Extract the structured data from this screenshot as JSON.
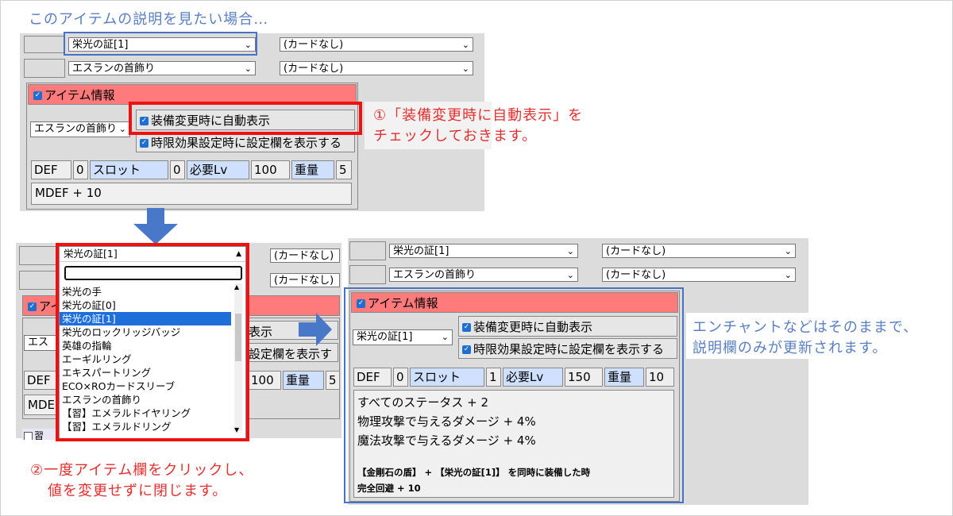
{
  "top_note": "このアイテムの説明を見たい場合…",
  "panel1": {
    "item_select_1": "栄光の証[1]",
    "card_select_1": "(カードなし)",
    "item_select_2": "エスランの首飾り",
    "card_select_2": "(カードなし)",
    "header": "アイテム情報",
    "item_dropdown": "エスランの首飾り",
    "opt_auto_display": "装備変更時に自動表示",
    "opt_timed_effect": "時限効果設定時に設定欄を表示する",
    "stats": [
      "DEF",
      "0",
      "スロット",
      "0",
      "必要Lv",
      "100",
      "重量",
      "5"
    ],
    "desc": "MDEF + 10"
  },
  "note1": [
    "①「装備変更時に自動表示」を",
    "チェックしておきます。"
  ],
  "panel2": {
    "dropdown_selected": "栄光の証[1]",
    "card_select_1": "(カードなし)",
    "card_select_2": "(カードなし)",
    "header_partial": "アイ",
    "item_partial": "エス",
    "opt_partial": "表示",
    "opt2_partial": "設定欄を表示す",
    "stats_partial": [
      "DEF",
      "100",
      "重量",
      "5"
    ],
    "desc_partial": "MDEF",
    "bottom_partial": "習",
    "list": [
      "栄光の手",
      "栄光の証[0]",
      "栄光の証[1]",
      "栄光のロックリッジバッジ",
      "英雄の指輪",
      "エーギルリング",
      "エキスパートリング",
      "ECO×ROカードスリーブ",
      "エスランの首飾り",
      "【習】エメラルドイヤリング",
      "【習】エメラルドリング"
    ]
  },
  "note2": [
    "②一度アイテム欄をクリックし、",
    "値を変更せずに閉じます。"
  ],
  "panel3": {
    "item_select_1": "栄光の証[1]",
    "card_select_1": "(カードなし)",
    "item_select_2": "エスランの首飾り",
    "card_select_2": "(カードなし)",
    "header": "アイテム情報",
    "item_dropdown": "栄光の証[1]",
    "opt_auto_display": "装備変更時に自動表示",
    "opt_timed_effect": "時限効果設定時に設定欄を表示する",
    "stats": [
      "DEF",
      "0",
      "スロット",
      "1",
      "必要Lv",
      "150",
      "重量",
      "10"
    ],
    "desc_lines": [
      "すべてのステータス + 2",
      "物理攻撃で与えるダメージ + 4%",
      "魔法攻撃で与えるダメージ + 4%"
    ],
    "set_lines": [
      "【金剛石の盾】 + 【栄光の証[1]】 を同時に装備した時",
      "完全回避 + 10"
    ]
  },
  "note3": [
    "エンチャントなどはそのままで、",
    "説明欄のみが更新されます。"
  ],
  "colors": {
    "accent_red": "#ee1111",
    "accent_blue": "#4a72c4",
    "header_bg": "#ff7b7b",
    "arrow": "#4a78c8"
  }
}
